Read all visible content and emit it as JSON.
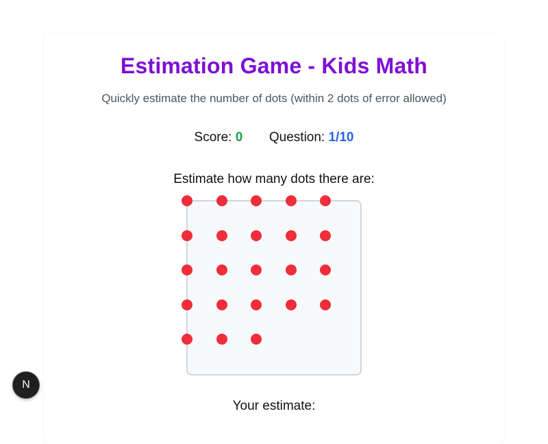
{
  "game": {
    "title": "Estimation Game - Kids Math",
    "subtitle": "Quickly estimate the number of dots (within 2 dots of error allowed)",
    "score_label": "Score:",
    "score_value": "0",
    "question_label": "Question:",
    "question_value": "1/10",
    "prompt": "Estimate how many dots there are:",
    "estimate_label": "Your estimate:",
    "dot_count": 23,
    "dot_color": "#f02d3a"
  },
  "colors": {
    "title": "#7e0fd6",
    "score": "#16a34a",
    "question": "#2563eb"
  },
  "dev_badge": {
    "letter": "N",
    "icon": "nextjs-dev-icon"
  }
}
